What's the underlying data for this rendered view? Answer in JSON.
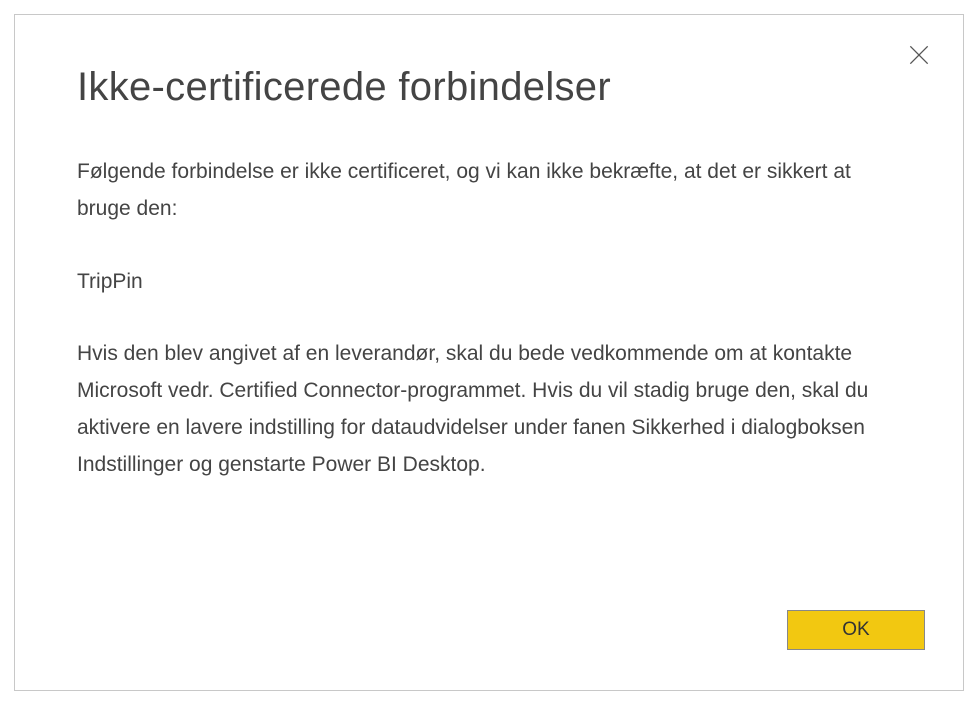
{
  "dialog": {
    "title": "Ikke-certificerede forbindelser",
    "intro": "Følgende forbindelse er ikke certificeret, og vi kan ikke bekræfte, at det er sikkert at bruge den:",
    "connector_name": "TripPin",
    "details": "Hvis den blev angivet af en leverandør, skal du bede vedkommende om at kontakte Microsoft vedr. Certified Connector-programmet. Hvis du vil stadig bruge den, skal du aktivere en lavere indstilling for dataudvidelser under fanen Sikkerhed i dialogboksen Indstillinger og genstarte Power BI Desktop.",
    "ok_label": "OK"
  }
}
